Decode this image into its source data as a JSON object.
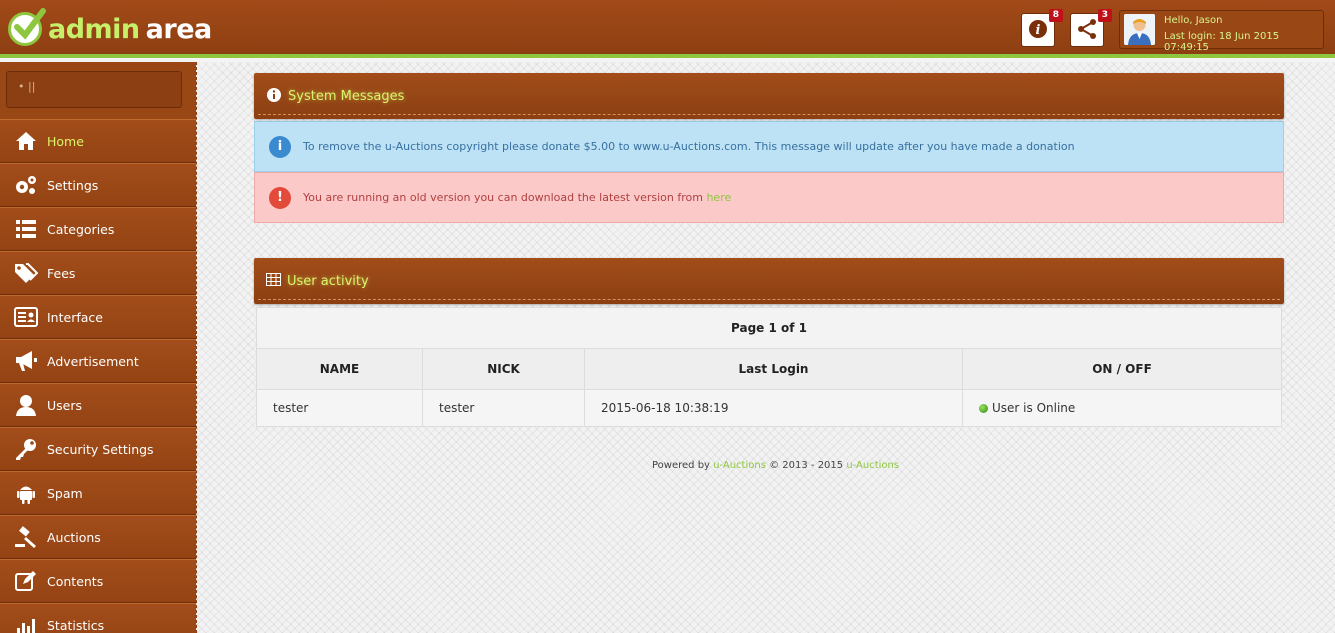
{
  "header": {
    "logo_accent": "admin",
    "logo_plain": "area",
    "info_badge": "8",
    "share_badge": "3",
    "user_hello": "Hello, Jason",
    "user_last_login": "Last login: 18 Jun 2015 07:49:15"
  },
  "sidebar": {
    "search_value": "•  ||",
    "items": [
      {
        "label": "Home",
        "icon": "home-icon"
      },
      {
        "label": "Settings",
        "icon": "gears-icon"
      },
      {
        "label": "Categories",
        "icon": "list-icon"
      },
      {
        "label": "Fees",
        "icon": "tags-icon"
      },
      {
        "label": "Interface",
        "icon": "id-card-icon"
      },
      {
        "label": "Advertisement",
        "icon": "megaphone-icon"
      },
      {
        "label": "Users",
        "icon": "user-icon"
      },
      {
        "label": "Security Settings",
        "icon": "key-icon"
      },
      {
        "label": "Spam",
        "icon": "android-icon"
      },
      {
        "label": "Auctions",
        "icon": "gavel-icon"
      },
      {
        "label": "Contents",
        "icon": "edit-icon"
      },
      {
        "label": "Statistics",
        "icon": "bar-chart-icon"
      }
    ]
  },
  "system_messages": {
    "title": "System Messages",
    "info": "To remove the u-Auctions copyright please donate $5.00 to www.u-Auctions.com. This message will update after you have made a donation",
    "warn_text": "You are running an old version you can download the latest version from ",
    "warn_link": "here"
  },
  "user_activity": {
    "title": "User activity",
    "page": "Page 1 of 1",
    "columns": [
      "NAME",
      "NICK",
      "Last Login",
      "ON / OFF"
    ],
    "rows": [
      {
        "name": "tester",
        "nick": "tester",
        "last_login": "2015-06-18 10:38:19",
        "status": "User is Online"
      }
    ]
  },
  "footer": {
    "prefix": "Powered by ",
    "link1": "u-Auctions",
    "middle": " © 2013 - 2015 ",
    "link2": "u-Auctions"
  },
  "colors": {
    "accent": "#d9f56a",
    "brand": "#9a4716",
    "green": "#8ec63f"
  }
}
